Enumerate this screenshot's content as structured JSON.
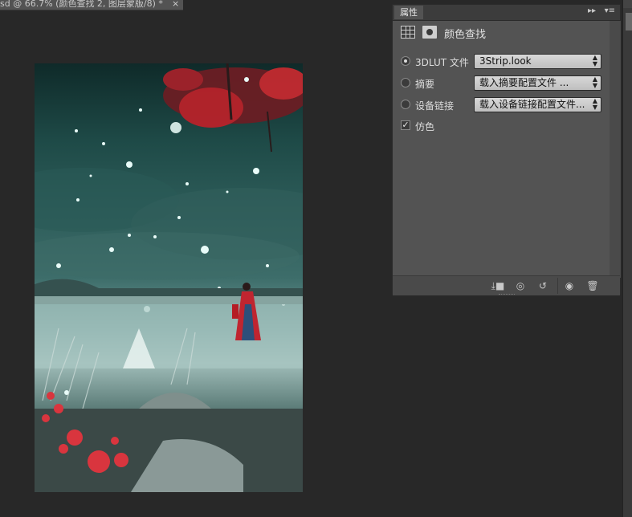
{
  "document_tab": {
    "title": "sd @ 66.7% (颜色查找 2, 图层蒙版/8) *",
    "close_glyph": "×"
  },
  "properties_panel": {
    "tab_label": "属性",
    "collapse_glyph": "▸▸",
    "menu_glyph": "▾≡",
    "adjustment_title": "颜色查找",
    "options": [
      {
        "label": "3DLUT 文件",
        "selected": true,
        "value": "3Strip.look"
      },
      {
        "label": "摘要",
        "selected": false,
        "value": "载入摘要配置文件 ..."
      },
      {
        "label": "设备链接",
        "selected": false,
        "value": "载入设备链接配置文件..."
      }
    ],
    "dither": {
      "label": "仿色",
      "checked": true,
      "check_glyph": "✓"
    },
    "footer_icons": [
      "clip-to-layer-icon",
      "view-previous-state-icon",
      "reset-icon",
      "visibility-eye-icon",
      "trash-icon"
    ],
    "footer_glyphs": [
      "⤓■",
      "◎",
      "↺",
      "◉",
      "🗑"
    ]
  },
  "canvas": {
    "description_colors": {
      "sky": "#1e4a47",
      "tree": "#b8222a",
      "water": "#9fbcb8"
    }
  }
}
